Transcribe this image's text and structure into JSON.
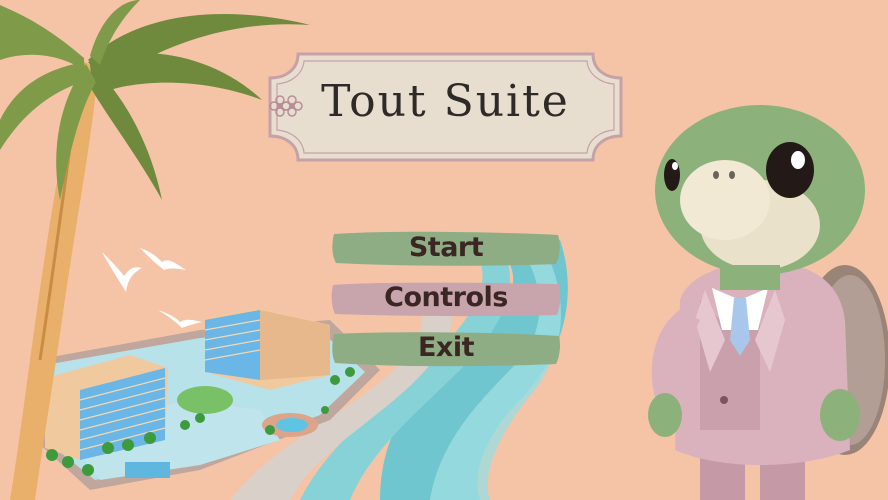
{
  "game": {
    "title": "Tout Suite"
  },
  "menu": {
    "items": [
      {
        "label": "Start",
        "color": "#8fad85"
      },
      {
        "label": "Controls",
        "color": "#c8a4ad"
      },
      {
        "label": "Exit",
        "color": "#8fad85"
      }
    ]
  },
  "colors": {
    "background": "#f5c4a7",
    "plaque": "#e8ded0",
    "plaque_border": "#c5a1a8",
    "text": "#2e2a28"
  },
  "icons": {
    "title_flourish": "flower-icon"
  }
}
